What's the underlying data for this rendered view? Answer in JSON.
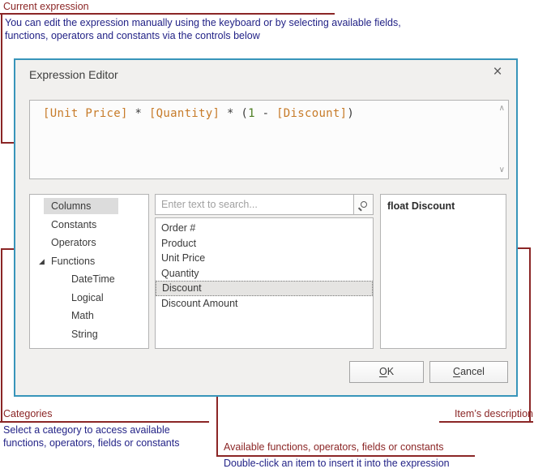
{
  "colors": {
    "callout": "#8b2626",
    "note_text": "#232387",
    "dialog_border": "#3895ba",
    "field_token": "#c77b29",
    "operator_token": "#3c3c3c",
    "number_token": "#4c7d22"
  },
  "annotations": {
    "current_expression": {
      "label": "Current expression",
      "lines": [
        "You can edit the expression manually using the keyboard or by selecting available fields,",
        "functions, operators and constants via the controls below"
      ]
    },
    "categories": {
      "label": "Categories",
      "lines": [
        "Select a category to access available",
        "functions, operators, fields or constants"
      ]
    },
    "available_items": {
      "label": "Available functions, operators, fields or constants",
      "line": "Double-click an item to insert it into the expression"
    },
    "item_description": {
      "label": "Item’s description"
    }
  },
  "dialog": {
    "title": "Expression Editor",
    "icons": {
      "close": "×",
      "functions_expand": "◢",
      "scroll_up": "∧",
      "scroll_down": "∨",
      "search": "css-magnifier"
    },
    "expression": {
      "tokens": [
        {
          "text": "[Unit Price]",
          "type": "field"
        },
        {
          "text": " * ",
          "type": "operator"
        },
        {
          "text": "[Quantity]",
          "type": "field"
        },
        {
          "text": " * ",
          "type": "operator"
        },
        {
          "text": "(",
          "type": "operator"
        },
        {
          "text": "1",
          "type": "number"
        },
        {
          "text": " - ",
          "type": "operator"
        },
        {
          "text": "[Discount]",
          "type": "field"
        },
        {
          "text": ")",
          "type": "operator"
        }
      ]
    },
    "categories": {
      "items": [
        {
          "label": "Columns",
          "level": 0,
          "selected": true
        },
        {
          "label": "Constants",
          "level": 0
        },
        {
          "label": "Operators",
          "level": 0
        },
        {
          "label": "Functions",
          "level": 0,
          "expanded": true
        },
        {
          "label": "DateTime",
          "level": 1
        },
        {
          "label": "Logical",
          "level": 1
        },
        {
          "label": "Math",
          "level": 1
        },
        {
          "label": "String",
          "level": 1
        }
      ]
    },
    "search": {
      "placeholder": "Enter text to search..."
    },
    "fields": {
      "items": [
        "Order #",
        "Product",
        "Unit Price",
        "Quantity",
        "Discount",
        "Discount Amount"
      ],
      "selected": "Discount"
    },
    "description": "float Discount",
    "buttons": {
      "ok": {
        "mnemonic": "O",
        "rest": "K"
      },
      "cancel": {
        "mnemonic": "C",
        "rest": "ancel"
      }
    }
  }
}
